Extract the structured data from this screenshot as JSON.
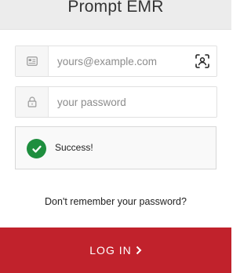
{
  "header": {
    "title": "Prompt EMR"
  },
  "email": {
    "placeholder": "yours@example.com",
    "icon": "id-card-icon",
    "action_icon": "face-id-icon"
  },
  "password": {
    "placeholder": "your password",
    "icon": "lock-icon"
  },
  "status": {
    "text": "Success!",
    "color": "#1e8e3e"
  },
  "forgot_link": "Don't remember your password?",
  "login_button": {
    "label": "LOG IN",
    "icon": "chevron-right-icon",
    "color": "#c1222c"
  }
}
